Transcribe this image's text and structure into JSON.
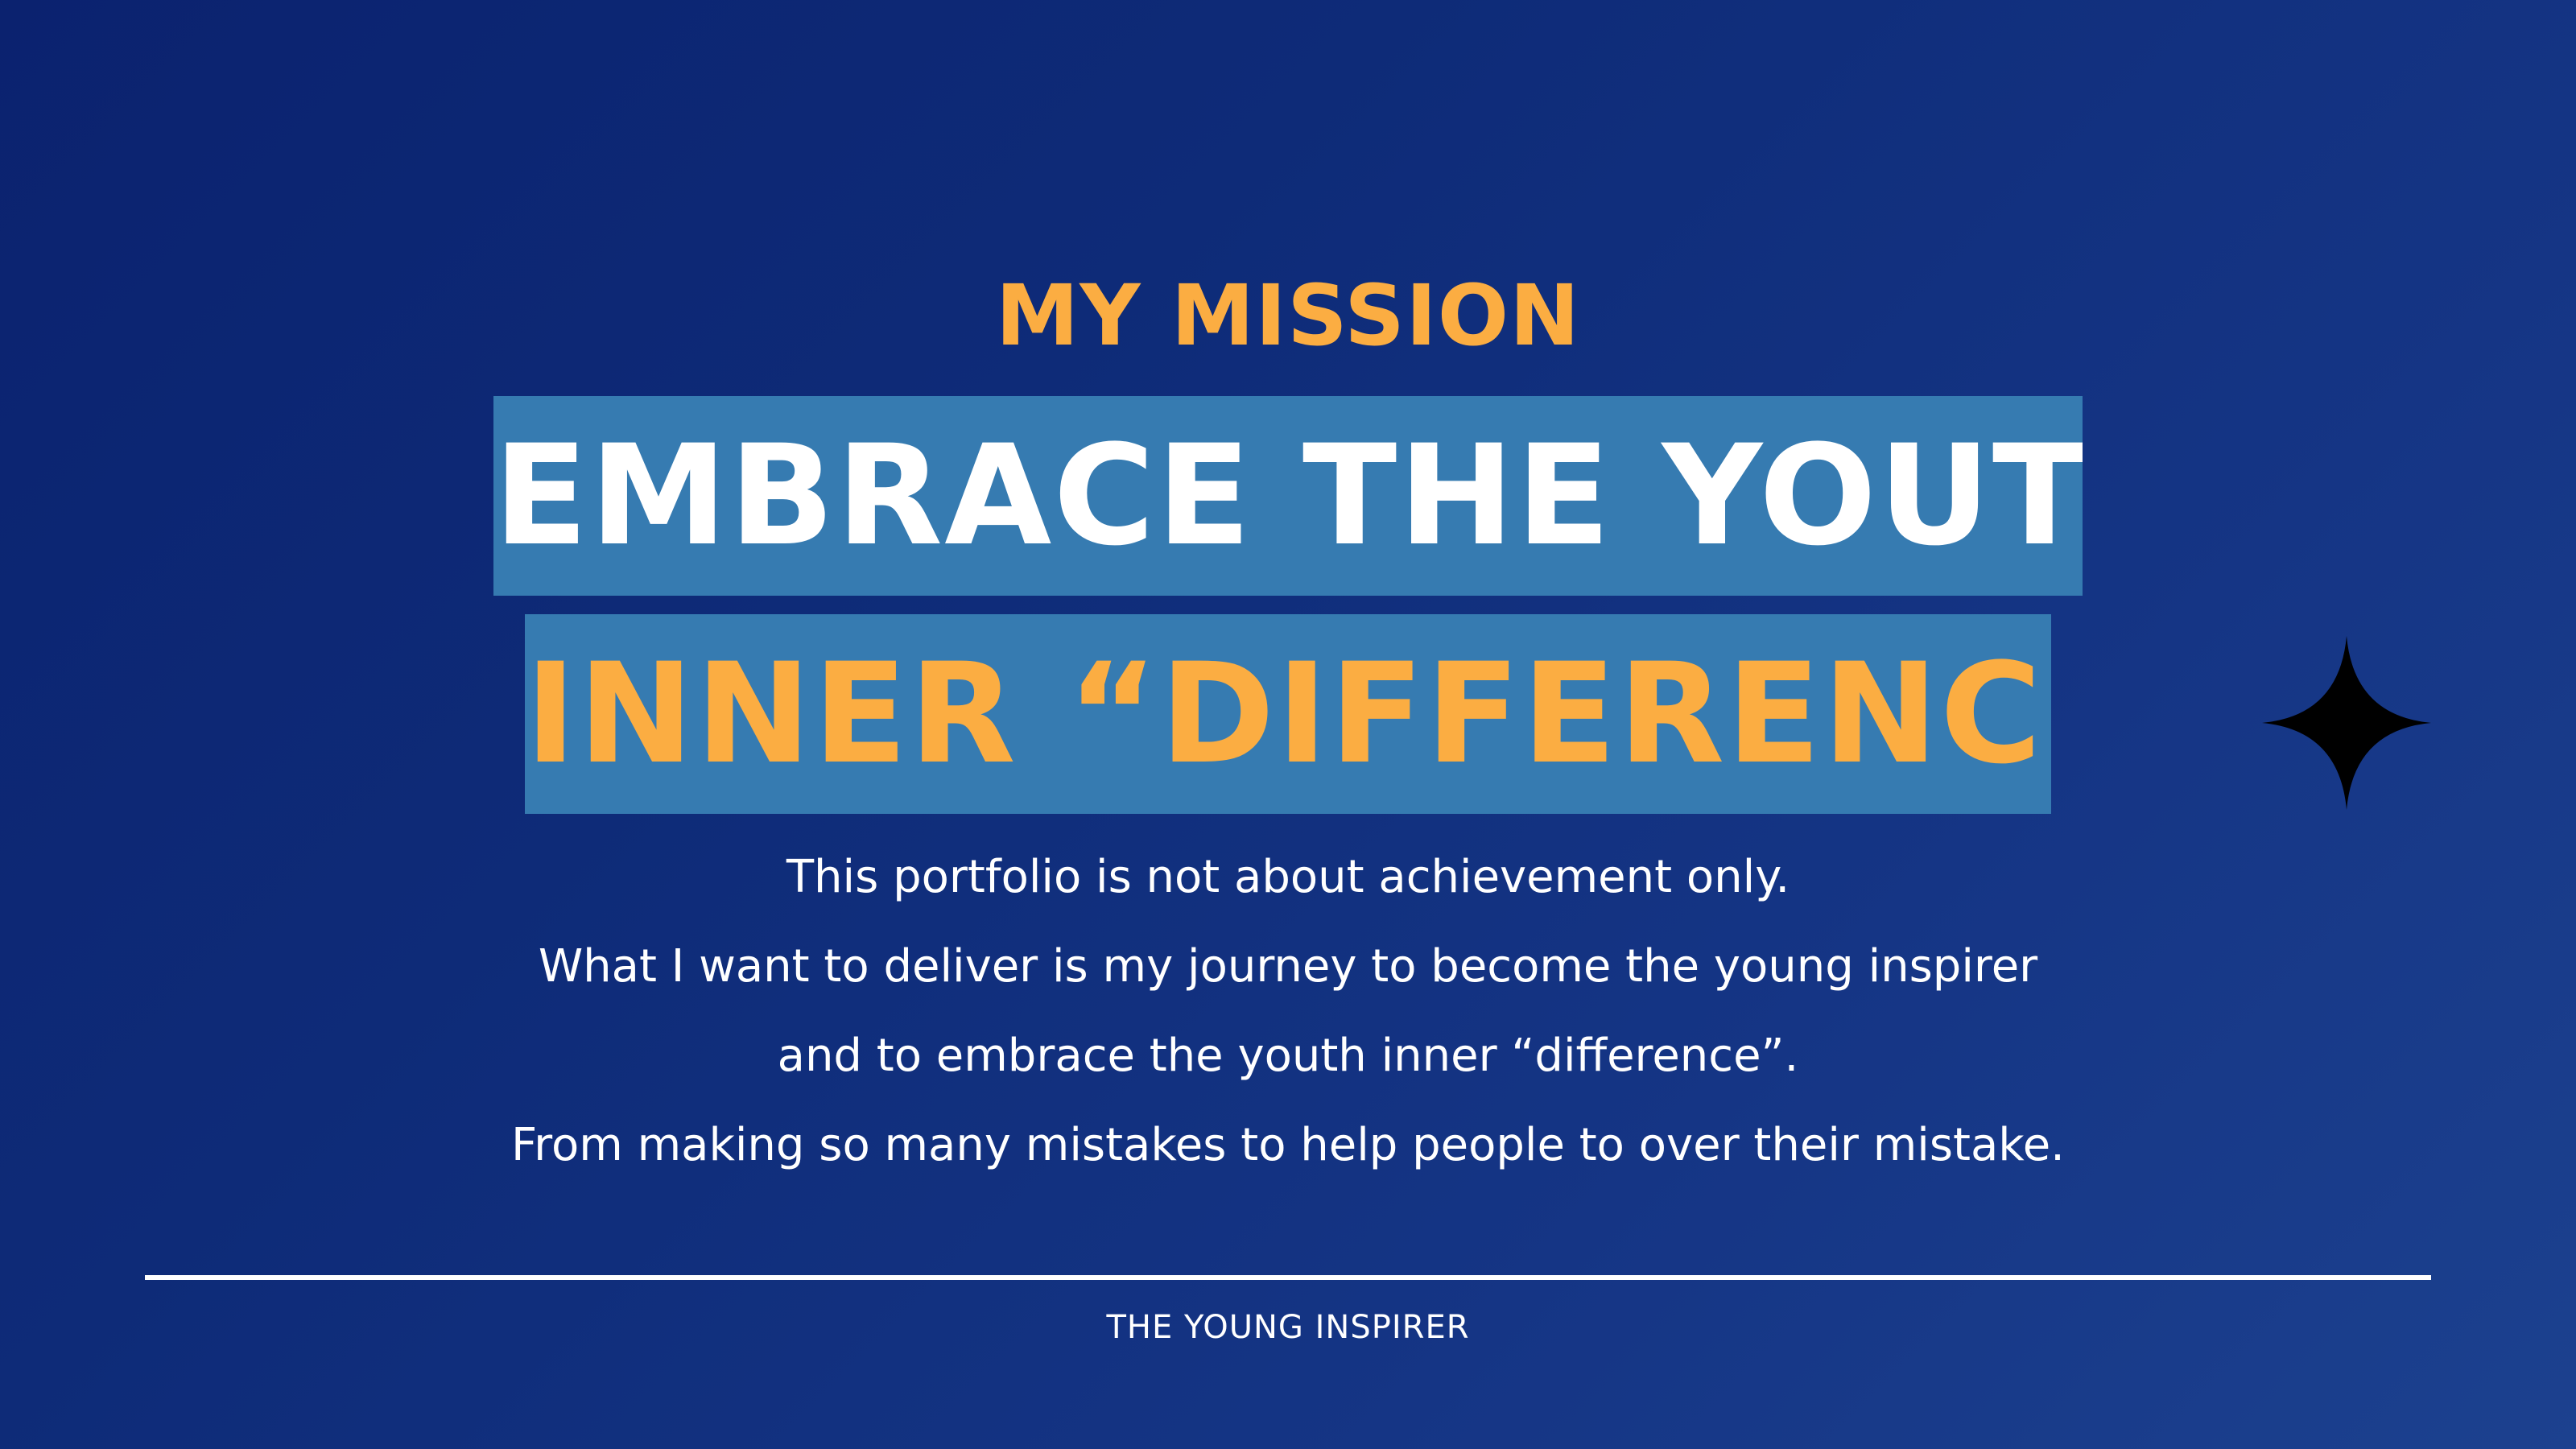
{
  "slide": {
    "kicker": "MY MISSION",
    "headline_line1": "EMBRACE THE YOUTH",
    "headline_line2": "INNER “DIFFERENCE”",
    "body_lines": [
      "This portfolio is not about achievement only.",
      "What I want to deliver is my journey to become the young inspirer",
      "and to embrace the youth inner “difference”.",
      "From making so many mistakes to help people to over their mistake."
    ],
    "footer": "THE YOUNG INSPIRER",
    "decoration_icon": "four-point-star-icon"
  },
  "colors": {
    "background_start": "#0b226f",
    "background_end": "#1c418f",
    "accent_orange": "#fbad42",
    "highlight_blue": "#367bb1",
    "text_white": "#ffffff",
    "star_black": "#000000"
  }
}
